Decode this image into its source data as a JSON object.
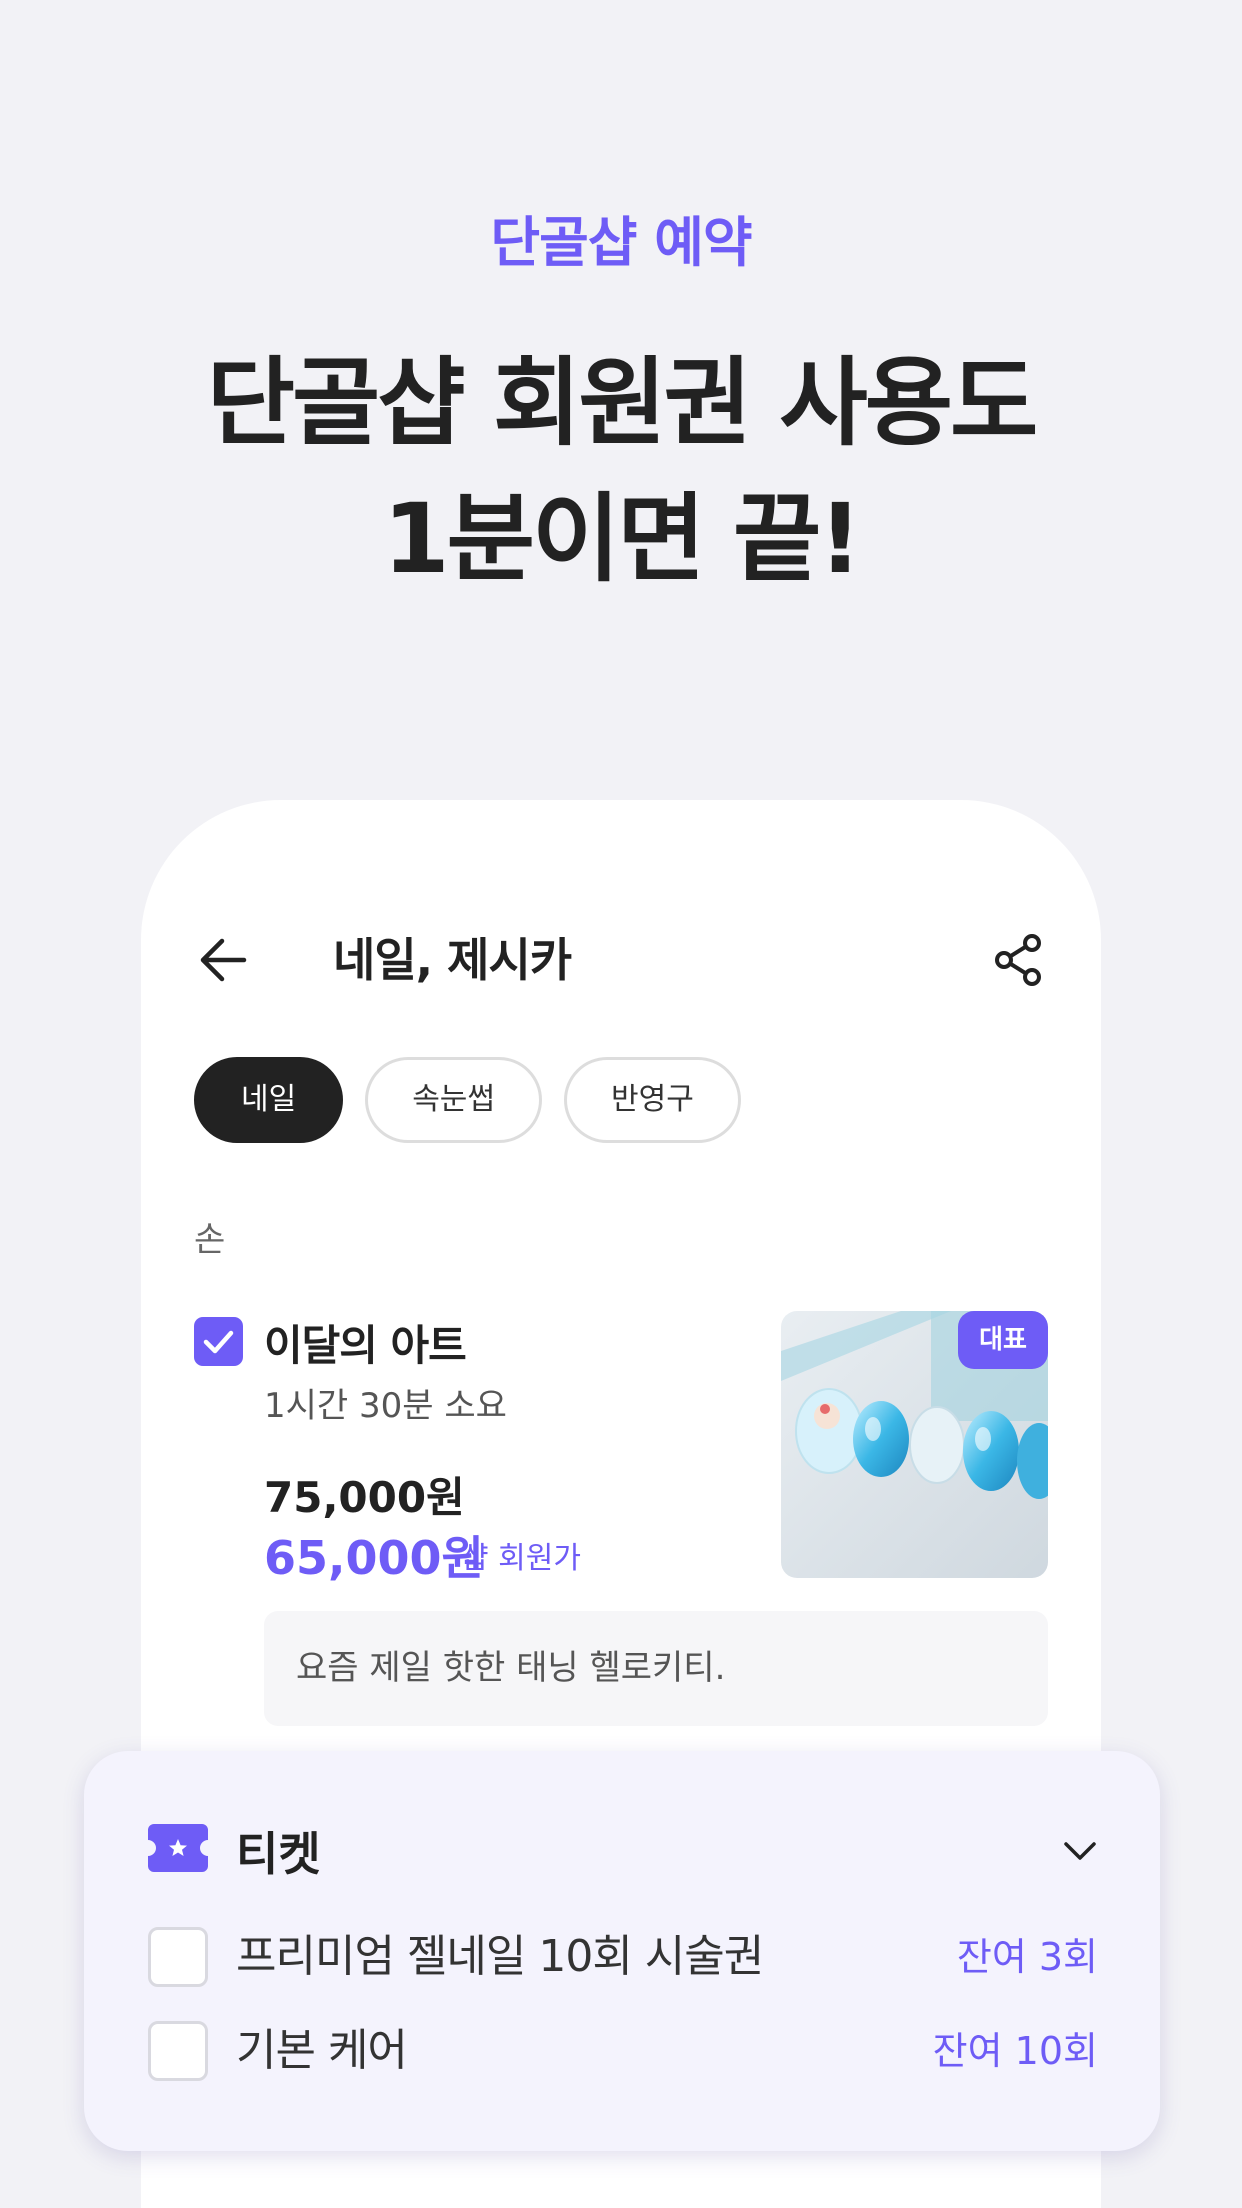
{
  "promo": {
    "eyebrow": "단골샵 예약",
    "headline_line1": "단골샵 회원권 사용도",
    "headline_line2": "1분이면 끝!"
  },
  "header": {
    "title": "네일, 제시카",
    "back_icon": "arrow-left-icon",
    "share_icon": "share-icon"
  },
  "categories": [
    {
      "label": "네일",
      "active": true
    },
    {
      "label": "속눈썹",
      "active": false
    },
    {
      "label": "반영구",
      "active": false
    }
  ],
  "section": {
    "label": "손"
  },
  "item": {
    "checked": true,
    "name": "이달의 아트",
    "duration": "1시간 30분 소요",
    "original_price": "75,000원",
    "member_price": "65,000원",
    "member_price_label": "샵 회원가",
    "badge": "대표",
    "memo": "요즘 제일 핫한 태닝 헬로키티."
  },
  "tickets": {
    "title": "티켓",
    "icon": "ticket-icon",
    "toggle_icon": "chevron-down-icon",
    "items": [
      {
        "name": "프리미엄 젤네일 10회 시술권",
        "remaining": "잔여 3회",
        "checked": false
      },
      {
        "name": "기본 케어",
        "remaining": "잔여 10회",
        "checked": false
      }
    ]
  },
  "colors": {
    "accent": "#6e5cf6",
    "background": "#f2f2f6",
    "panel": "#f4f3fd",
    "text": "#222222"
  }
}
